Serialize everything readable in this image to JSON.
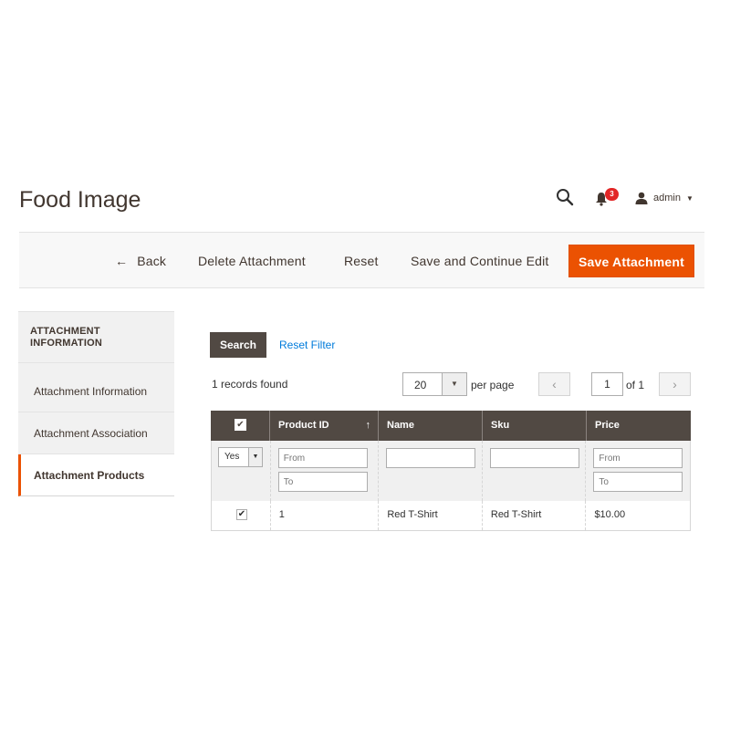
{
  "page": {
    "title": "Food Image"
  },
  "header": {
    "notifications_count": "3",
    "user": "admin"
  },
  "toolbar": {
    "back_label": "Back",
    "delete_label": "Delete Attachment",
    "reset_label": "Reset",
    "save_continue_label": "Save and Continue Edit",
    "save_label": "Save Attachment"
  },
  "sidebar": {
    "heading": "ATTACHMENT INFORMATION",
    "items": [
      {
        "label": "Attachment Information"
      },
      {
        "label": "Attachment Association"
      },
      {
        "label": "Attachment Products"
      }
    ]
  },
  "grid_controls": {
    "search_label": "Search",
    "reset_filter_label": "Reset Filter",
    "records_found": "1 records found",
    "per_page_value": "20",
    "per_page_label": "per page",
    "current_page": "1",
    "of_pages": "of 1"
  },
  "grid": {
    "columns": [
      "Product ID",
      "Name",
      "Sku",
      "Price"
    ],
    "filters": {
      "in_products": "Yes",
      "from_placeholder": "From",
      "to_placeholder": "To"
    },
    "rows": [
      {
        "checked": true,
        "product_id": "1",
        "name": "Red T-Shirt",
        "sku": "Red T-Shirt",
        "price": "$10.00"
      }
    ]
  },
  "colors": {
    "accent": "#eb5202",
    "header_dark": "#514943",
    "link": "#007bdb",
    "badge": "#e22626"
  }
}
